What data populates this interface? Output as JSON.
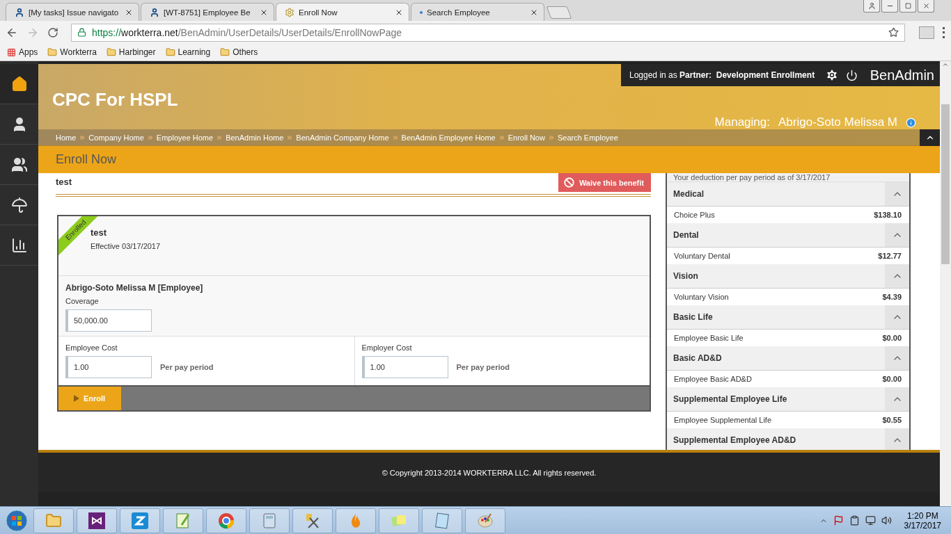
{
  "browser": {
    "tabs": [
      {
        "label": "[My tasks] Issue navigato",
        "selected": false
      },
      {
        "label": "[WT-8751] Employee Be",
        "selected": false
      },
      {
        "label": "Enroll Now",
        "selected": true
      },
      {
        "label": "Search Employee",
        "selected": false
      }
    ],
    "url": {
      "scheme": "https://",
      "host": "workterra.net",
      "path": "/BenAdmin/UserDetails/UserDetails/EnrollNowPage"
    },
    "bookmarks": [
      "Apps",
      "Workterra",
      "Harbinger",
      "Learning",
      "Others"
    ]
  },
  "sidebar": {
    "items": [
      {
        "selected": true
      },
      {
        "selected": false
      },
      {
        "selected": false
      },
      {
        "selected": false
      },
      {
        "selected": false
      }
    ]
  },
  "header": {
    "login_prefix": "Logged in as",
    "login_role": "Partner:",
    "login_name": "Development Enrollment",
    "app_name": "BenAdmin",
    "company": "CPC For HSPL",
    "managing_label": "Managing:",
    "managing_name": "Abrigo-Soto Melissa M"
  },
  "breadcrumbs": [
    "Home",
    "Company Home",
    "Employee Home",
    "BenAdmin Home",
    "BenAdmin Company Home",
    "BenAdmin Employee Home",
    "Enroll Now",
    "Search Employee"
  ],
  "page_title": "Enroll Now",
  "plan": {
    "title": "test",
    "waive_button": "Waive this benefit",
    "card": {
      "ribbon": "Enrolled",
      "name": "test",
      "effective": "Effective 03/17/2017",
      "member": "Abrigo-Soto Melissa M [Employee]",
      "coverage_label": "Coverage",
      "coverage_value": "50,000.00",
      "costs": [
        {
          "label": "Employee Cost",
          "value": "1.00",
          "period": "Per pay period"
        },
        {
          "label": "Employer Cost",
          "value": "1.00",
          "period": "Per pay period"
        }
      ],
      "enroll_button": "Enroll"
    }
  },
  "deductions": {
    "caption": "Your deduction per pay period as of 3/17/2017",
    "groups": [
      {
        "name": "Medical",
        "expanded": true,
        "items": [
          {
            "name": "Choice Plus",
            "amount": "$138.10"
          }
        ]
      },
      {
        "name": "Dental",
        "expanded": true,
        "items": [
          {
            "name": "Voluntary Dental",
            "amount": "$12.77"
          }
        ]
      },
      {
        "name": "Vision",
        "expanded": true,
        "items": [
          {
            "name": "Voluntary Vision",
            "amount": "$4.39"
          }
        ]
      },
      {
        "name": "Basic Life",
        "expanded": true,
        "items": [
          {
            "name": "Employee Basic Life",
            "amount": "$0.00"
          }
        ]
      },
      {
        "name": "Basic AD&D",
        "expanded": true,
        "items": [
          {
            "name": "Employee Basic AD&D",
            "amount": "$0.00"
          }
        ]
      },
      {
        "name": "Supplemental Employee Life",
        "expanded": true,
        "items": [
          {
            "name": "Employee Supplemental Life",
            "amount": "$0.55"
          }
        ]
      },
      {
        "name": "Supplemental Employee AD&D",
        "expanded": true
      }
    ]
  },
  "footer": "© Copyright 2013-2014 WORKTERRA LLC. All rights reserved.",
  "taskbar": {
    "time": "1:20 PM",
    "date": "3/17/2017"
  }
}
